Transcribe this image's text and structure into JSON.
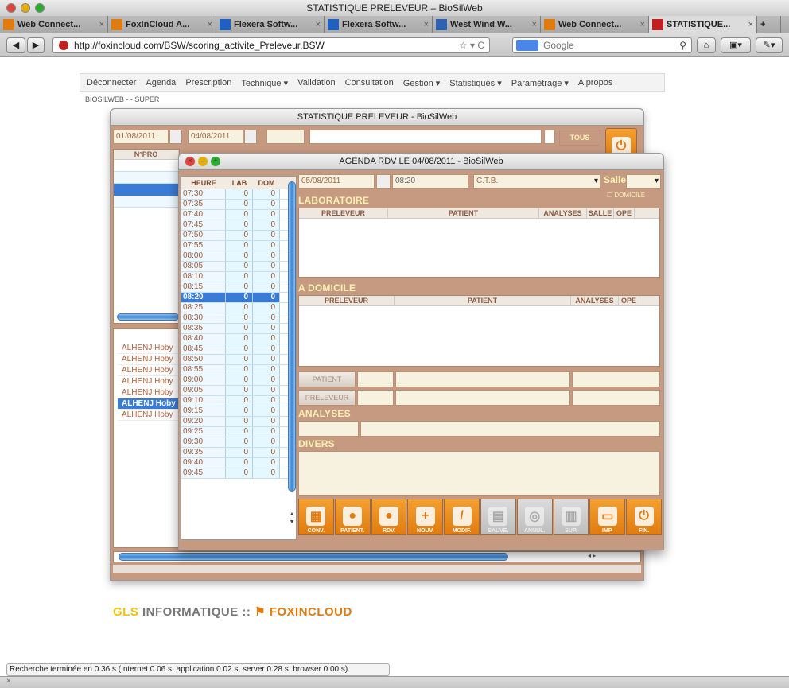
{
  "window_title": "STATISTIQUE PRELEVEUR – BioSilWeb",
  "tabs": [
    {
      "label": "Web Connect...",
      "active": false
    },
    {
      "label": "FoxInCloud A...",
      "active": false
    },
    {
      "label": "Flexera Softw...",
      "active": false
    },
    {
      "label": "Flexera Softw...",
      "active": false
    },
    {
      "label": "West Wind W...",
      "active": false
    },
    {
      "label": "Web Connect...",
      "active": false
    },
    {
      "label": "STATISTIQUE...",
      "active": true
    }
  ],
  "url": "http://foxincloud.com/BSW/scoring_activite_Preleveur.BSW",
  "search_placeholder": "Google",
  "menu": [
    "Déconnecter",
    "Agenda",
    "Prescription",
    "Technique ▾",
    "Validation",
    "Consultation",
    "Gestion ▾",
    "Statistiques ▾",
    "Paramétrage ▾",
    "A propos"
  ],
  "breadcrumb": "BIOSILWEB - - SUPER",
  "win1": {
    "title": "STATISTIQUE PRELEVEUR - BioSilWeb",
    "date_from": "01/08/2011",
    "date_to": "04/08/2011",
    "tous_label": "TOUS",
    "col_npro": "N°PRO",
    "names": [
      "ALHENJ Hoby",
      "ALHENJ Hoby",
      "ALHENJ Hoby",
      "ALHENJ Hoby",
      "ALHENJ Hoby",
      "ALHENJ Hoby",
      "ALHENJ Hoby"
    ],
    "selected_name_index": 5
  },
  "win2": {
    "title": "AGENDA RDV LE 04/08/2011 - BioSilWeb",
    "date": "05/08/2011",
    "time": "08:20",
    "site": "C.T.B.",
    "salle_label": "Salle",
    "domicile_label": "DOMICILE",
    "agenda_headers": [
      "HEURE",
      "LAB",
      "DOM"
    ],
    "agenda_rows": [
      [
        "07:30",
        "0",
        "0"
      ],
      [
        "07:35",
        "0",
        "0"
      ],
      [
        "07:40",
        "0",
        "0"
      ],
      [
        "07:45",
        "0",
        "0"
      ],
      [
        "07:50",
        "0",
        "0"
      ],
      [
        "07:55",
        "0",
        "0"
      ],
      [
        "08:00",
        "0",
        "0"
      ],
      [
        "08:05",
        "0",
        "0"
      ],
      [
        "08:10",
        "0",
        "0"
      ],
      [
        "08:15",
        "0",
        "0"
      ],
      [
        "08:20",
        "0",
        "0"
      ],
      [
        "08:25",
        "0",
        "0"
      ],
      [
        "08:30",
        "0",
        "0"
      ],
      [
        "08:35",
        "0",
        "0"
      ],
      [
        "08:40",
        "0",
        "0"
      ],
      [
        "08:45",
        "0",
        "0"
      ],
      [
        "08:50",
        "0",
        "0"
      ],
      [
        "08:55",
        "0",
        "0"
      ],
      [
        "09:00",
        "0",
        "0"
      ],
      [
        "09:05",
        "0",
        "0"
      ],
      [
        "09:10",
        "0",
        "0"
      ],
      [
        "09:15",
        "0",
        "0"
      ],
      [
        "09:20",
        "0",
        "0"
      ],
      [
        "09:25",
        "0",
        "0"
      ],
      [
        "09:30",
        "0",
        "0"
      ],
      [
        "09:35",
        "0",
        "0"
      ],
      [
        "09:40",
        "0",
        "0"
      ],
      [
        "09:45",
        "0",
        "0"
      ]
    ],
    "selected_row_index": 10,
    "sections": {
      "laboratoire": "LABORATOIRE",
      "domicile": "A DOMICILE",
      "analyses": "ANALYSES",
      "divers": "DIVERS"
    },
    "lab_headers": [
      "PRELEVEUR",
      "PATIENT",
      "ANALYSES",
      "SALLE",
      "OPE"
    ],
    "dom_headers": [
      "PRELEVEUR",
      "PATIENT",
      "ANALYSES",
      "OPE"
    ],
    "patient_btn": "PATIENT",
    "preleveur_btn": "PRELEVEUR",
    "toolbar": [
      {
        "label": "CONV.",
        "icon": "calendar-icon",
        "enabled": true
      },
      {
        "label": "PATIENT.",
        "icon": "speech-bubble-icon",
        "enabled": true
      },
      {
        "label": "RDV.",
        "icon": "speech-bubble-icon",
        "enabled": true
      },
      {
        "label": "NOUV.",
        "icon": "plus-icon",
        "enabled": true
      },
      {
        "label": "MODIF.",
        "icon": "pencil-icon",
        "enabled": true
      },
      {
        "label": "SAUVE.",
        "icon": "save-icon",
        "enabled": false
      },
      {
        "label": "ANNUL.",
        "icon": "cancel-icon",
        "enabled": false
      },
      {
        "label": "SUP.",
        "icon": "trash-icon",
        "enabled": false
      },
      {
        "label": "IMP.",
        "icon": "printer-icon",
        "enabled": true
      },
      {
        "label": "FIN.",
        "icon": "power-icon",
        "enabled": true
      }
    ]
  },
  "footer_logo": {
    "left": "GLS",
    "left_rest": "INFORMATIQUE ::",
    "right": "FOXINCLOUD"
  },
  "status_text": "Recherche terminée en 0.36 s (Internet 0.06 s, application 0.02 s, server 0.28 s, browser 0.00 s)",
  "colors": {
    "accent": "#e07b10",
    "panel": "#c69a80",
    "selection": "#3a7bd5",
    "section_text": "#f9f1b5"
  }
}
